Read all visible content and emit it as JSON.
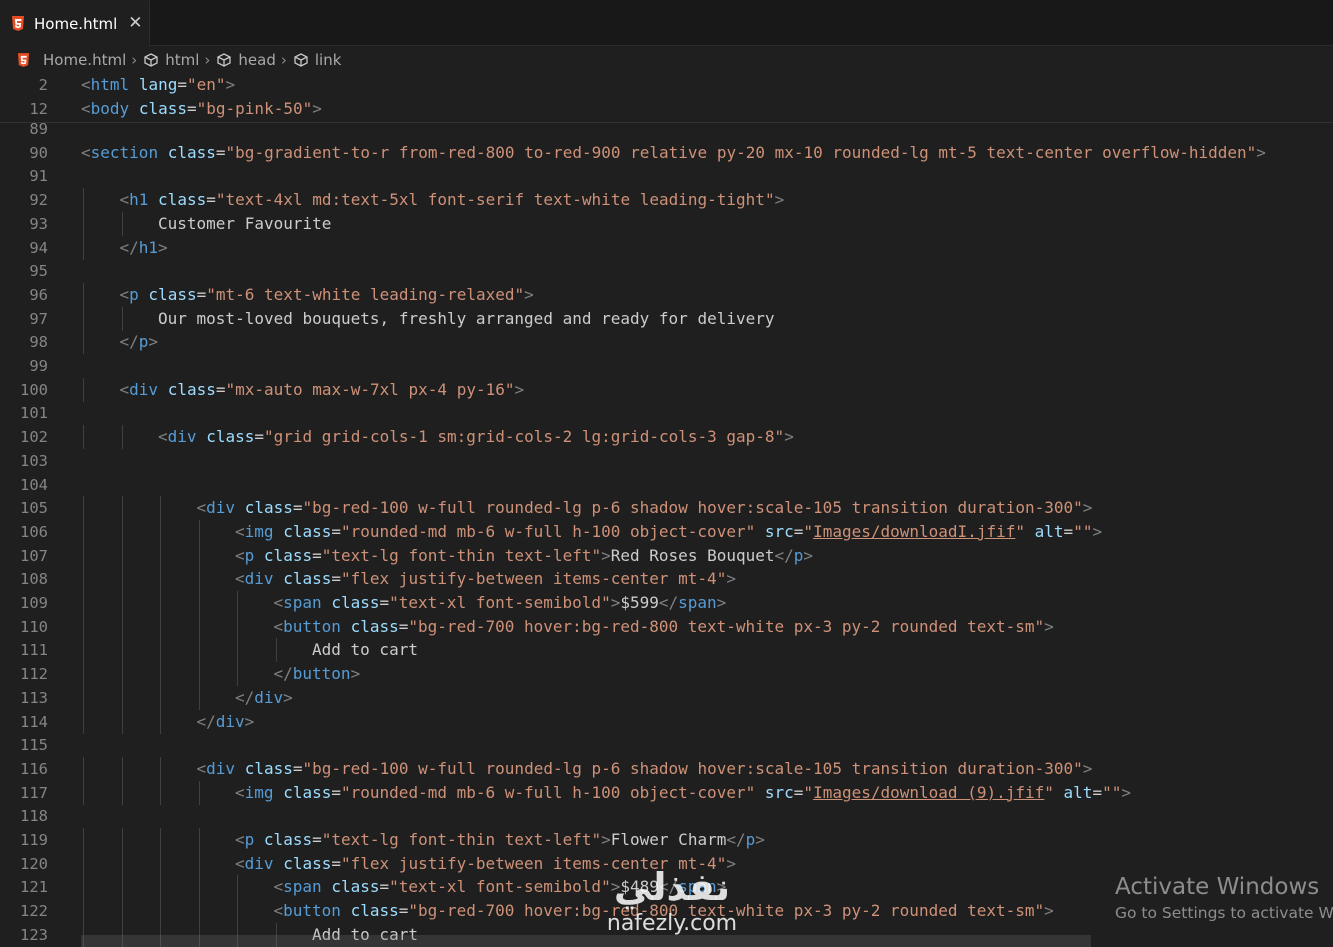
{
  "tab": {
    "title": "Home.html",
    "close": "✕",
    "icon": "html5-file-icon"
  },
  "breadcrumb": {
    "file": "Home.html",
    "items": [
      "html",
      "head",
      "link"
    ],
    "separator": "›"
  },
  "watermark": {
    "title": "Activate Windows",
    "subtitle": "Go to Settings to activate Windows."
  },
  "brand": {
    "arabic": "نفذلي",
    "latin": "nafezly.com"
  },
  "colors": {
    "background": "#1f1f1f",
    "tag": "#569cd6",
    "attribute": "#9cdcfe",
    "string": "#ce9178",
    "bracket": "#808080",
    "text": "#cccccc",
    "line_number": "#858585"
  },
  "lines": [
    {
      "n": "2",
      "indent": 0,
      "kind": "open",
      "tag": "html",
      "attrs": [
        [
          "lang",
          "en"
        ]
      ]
    },
    {
      "n": "12",
      "indent": 0,
      "kind": "open",
      "tag": "body",
      "attrs": [
        [
          "class",
          "bg-pink-50"
        ]
      ]
    },
    {
      "n": "89",
      "indent": 0,
      "kind": "blank"
    },
    {
      "n": "90",
      "indent": 0,
      "kind": "open",
      "tag": "section",
      "attrs": [
        [
          "class",
          "bg-gradient-to-r from-red-800 to-red-900 relative py-20 mx-10 rounded-lg mt-5 text-center overflow-hidden"
        ]
      ]
    },
    {
      "n": "91",
      "indent": 0,
      "kind": "blank"
    },
    {
      "n": "92",
      "indent": 1,
      "kind": "open",
      "tag": "h1",
      "attrs": [
        [
          "class",
          "text-4xl md:text-5xl font-serif text-white leading-tight"
        ]
      ]
    },
    {
      "n": "93",
      "indent": 2,
      "kind": "text",
      "text": "Customer Favourite"
    },
    {
      "n": "94",
      "indent": 1,
      "kind": "close",
      "tag": "h1"
    },
    {
      "n": "95",
      "indent": 0,
      "kind": "blank"
    },
    {
      "n": "96",
      "indent": 1,
      "kind": "open",
      "tag": "p",
      "attrs": [
        [
          "class",
          "mt-6 text-white leading-relaxed"
        ]
      ]
    },
    {
      "n": "97",
      "indent": 2,
      "kind": "text",
      "text": "Our most-loved bouquets, freshly arranged and ready for delivery"
    },
    {
      "n": "98",
      "indent": 1,
      "kind": "close",
      "tag": "p"
    },
    {
      "n": "99",
      "indent": 0,
      "kind": "blank"
    },
    {
      "n": "100",
      "indent": 1,
      "kind": "open",
      "tag": "div",
      "attrs": [
        [
          "class",
          "mx-auto max-w-7xl px-4 py-16"
        ]
      ]
    },
    {
      "n": "101",
      "indent": 0,
      "kind": "blank"
    },
    {
      "n": "102",
      "indent": 2,
      "kind": "open",
      "tag": "div",
      "attrs": [
        [
          "class",
          "grid grid-cols-1 sm:grid-cols-2 lg:grid-cols-3 gap-8"
        ]
      ]
    },
    {
      "n": "103",
      "indent": 0,
      "kind": "blank"
    },
    {
      "n": "104",
      "indent": 0,
      "kind": "blank"
    },
    {
      "n": "105",
      "indent": 3,
      "kind": "open",
      "tag": "div",
      "attrs": [
        [
          "class",
          "bg-red-100 w-full rounded-lg p-6 shadow hover:scale-105 transition duration-300"
        ]
      ]
    },
    {
      "n": "106",
      "indent": 4,
      "kind": "open",
      "tag": "img",
      "attrs": [
        [
          "class",
          "rounded-md mb-6 w-full h-100 object-cover"
        ],
        [
          "src",
          "Images/downloadI.jfif"
        ],
        [
          "alt",
          ""
        ]
      ],
      "link_attr": "src"
    },
    {
      "n": "107",
      "indent": 4,
      "kind": "inline",
      "tag": "p",
      "attrs": [
        [
          "class",
          "text-lg font-thin text-left"
        ]
      ],
      "text": "Red Roses Bouquet"
    },
    {
      "n": "108",
      "indent": 4,
      "kind": "open",
      "tag": "div",
      "attrs": [
        [
          "class",
          "flex justify-between items-center mt-4"
        ]
      ]
    },
    {
      "n": "109",
      "indent": 5,
      "kind": "inline",
      "tag": "span",
      "attrs": [
        [
          "class",
          "text-xl font-semibold"
        ]
      ],
      "text": "$599"
    },
    {
      "n": "110",
      "indent": 5,
      "kind": "open",
      "tag": "button",
      "attrs": [
        [
          "class",
          "bg-red-700 hover:bg-red-800 text-white px-3 py-2 rounded text-sm"
        ]
      ]
    },
    {
      "n": "111",
      "indent": 6,
      "kind": "text",
      "text": "Add to cart"
    },
    {
      "n": "112",
      "indent": 5,
      "kind": "close",
      "tag": "button"
    },
    {
      "n": "113",
      "indent": 4,
      "kind": "close",
      "tag": "div"
    },
    {
      "n": "114",
      "indent": 3,
      "kind": "close",
      "tag": "div"
    },
    {
      "n": "115",
      "indent": 0,
      "kind": "blank"
    },
    {
      "n": "116",
      "indent": 3,
      "kind": "open",
      "tag": "div",
      "attrs": [
        [
          "class",
          "bg-red-100 w-full rounded-lg p-6 shadow hover:scale-105 transition duration-300"
        ]
      ]
    },
    {
      "n": "117",
      "indent": 4,
      "kind": "open",
      "tag": "img",
      "attrs": [
        [
          "class",
          "rounded-md mb-6 w-full h-100 object-cover"
        ],
        [
          "src",
          "Images/download (9).jfif"
        ],
        [
          "alt",
          ""
        ]
      ],
      "link_attr": "src"
    },
    {
      "n": "118",
      "indent": 0,
      "kind": "blank"
    },
    {
      "n": "119",
      "indent": 4,
      "kind": "inline",
      "tag": "p",
      "attrs": [
        [
          "class",
          "text-lg font-thin text-left"
        ]
      ],
      "text": "Flower Charm"
    },
    {
      "n": "120",
      "indent": 4,
      "kind": "open",
      "tag": "div",
      "attrs": [
        [
          "class",
          "flex justify-between items-center mt-4"
        ]
      ]
    },
    {
      "n": "121",
      "indent": 5,
      "kind": "inline",
      "tag": "span",
      "attrs": [
        [
          "class",
          "text-xl font-semibold"
        ]
      ],
      "text": "$489"
    },
    {
      "n": "122",
      "indent": 5,
      "kind": "open",
      "tag": "button",
      "attrs": [
        [
          "class",
          "bg-red-700 hover:bg-red-800 text-white px-3 py-2 rounded text-sm"
        ]
      ]
    },
    {
      "n": "123",
      "indent": 6,
      "kind": "text",
      "text": "Add to cart"
    }
  ]
}
